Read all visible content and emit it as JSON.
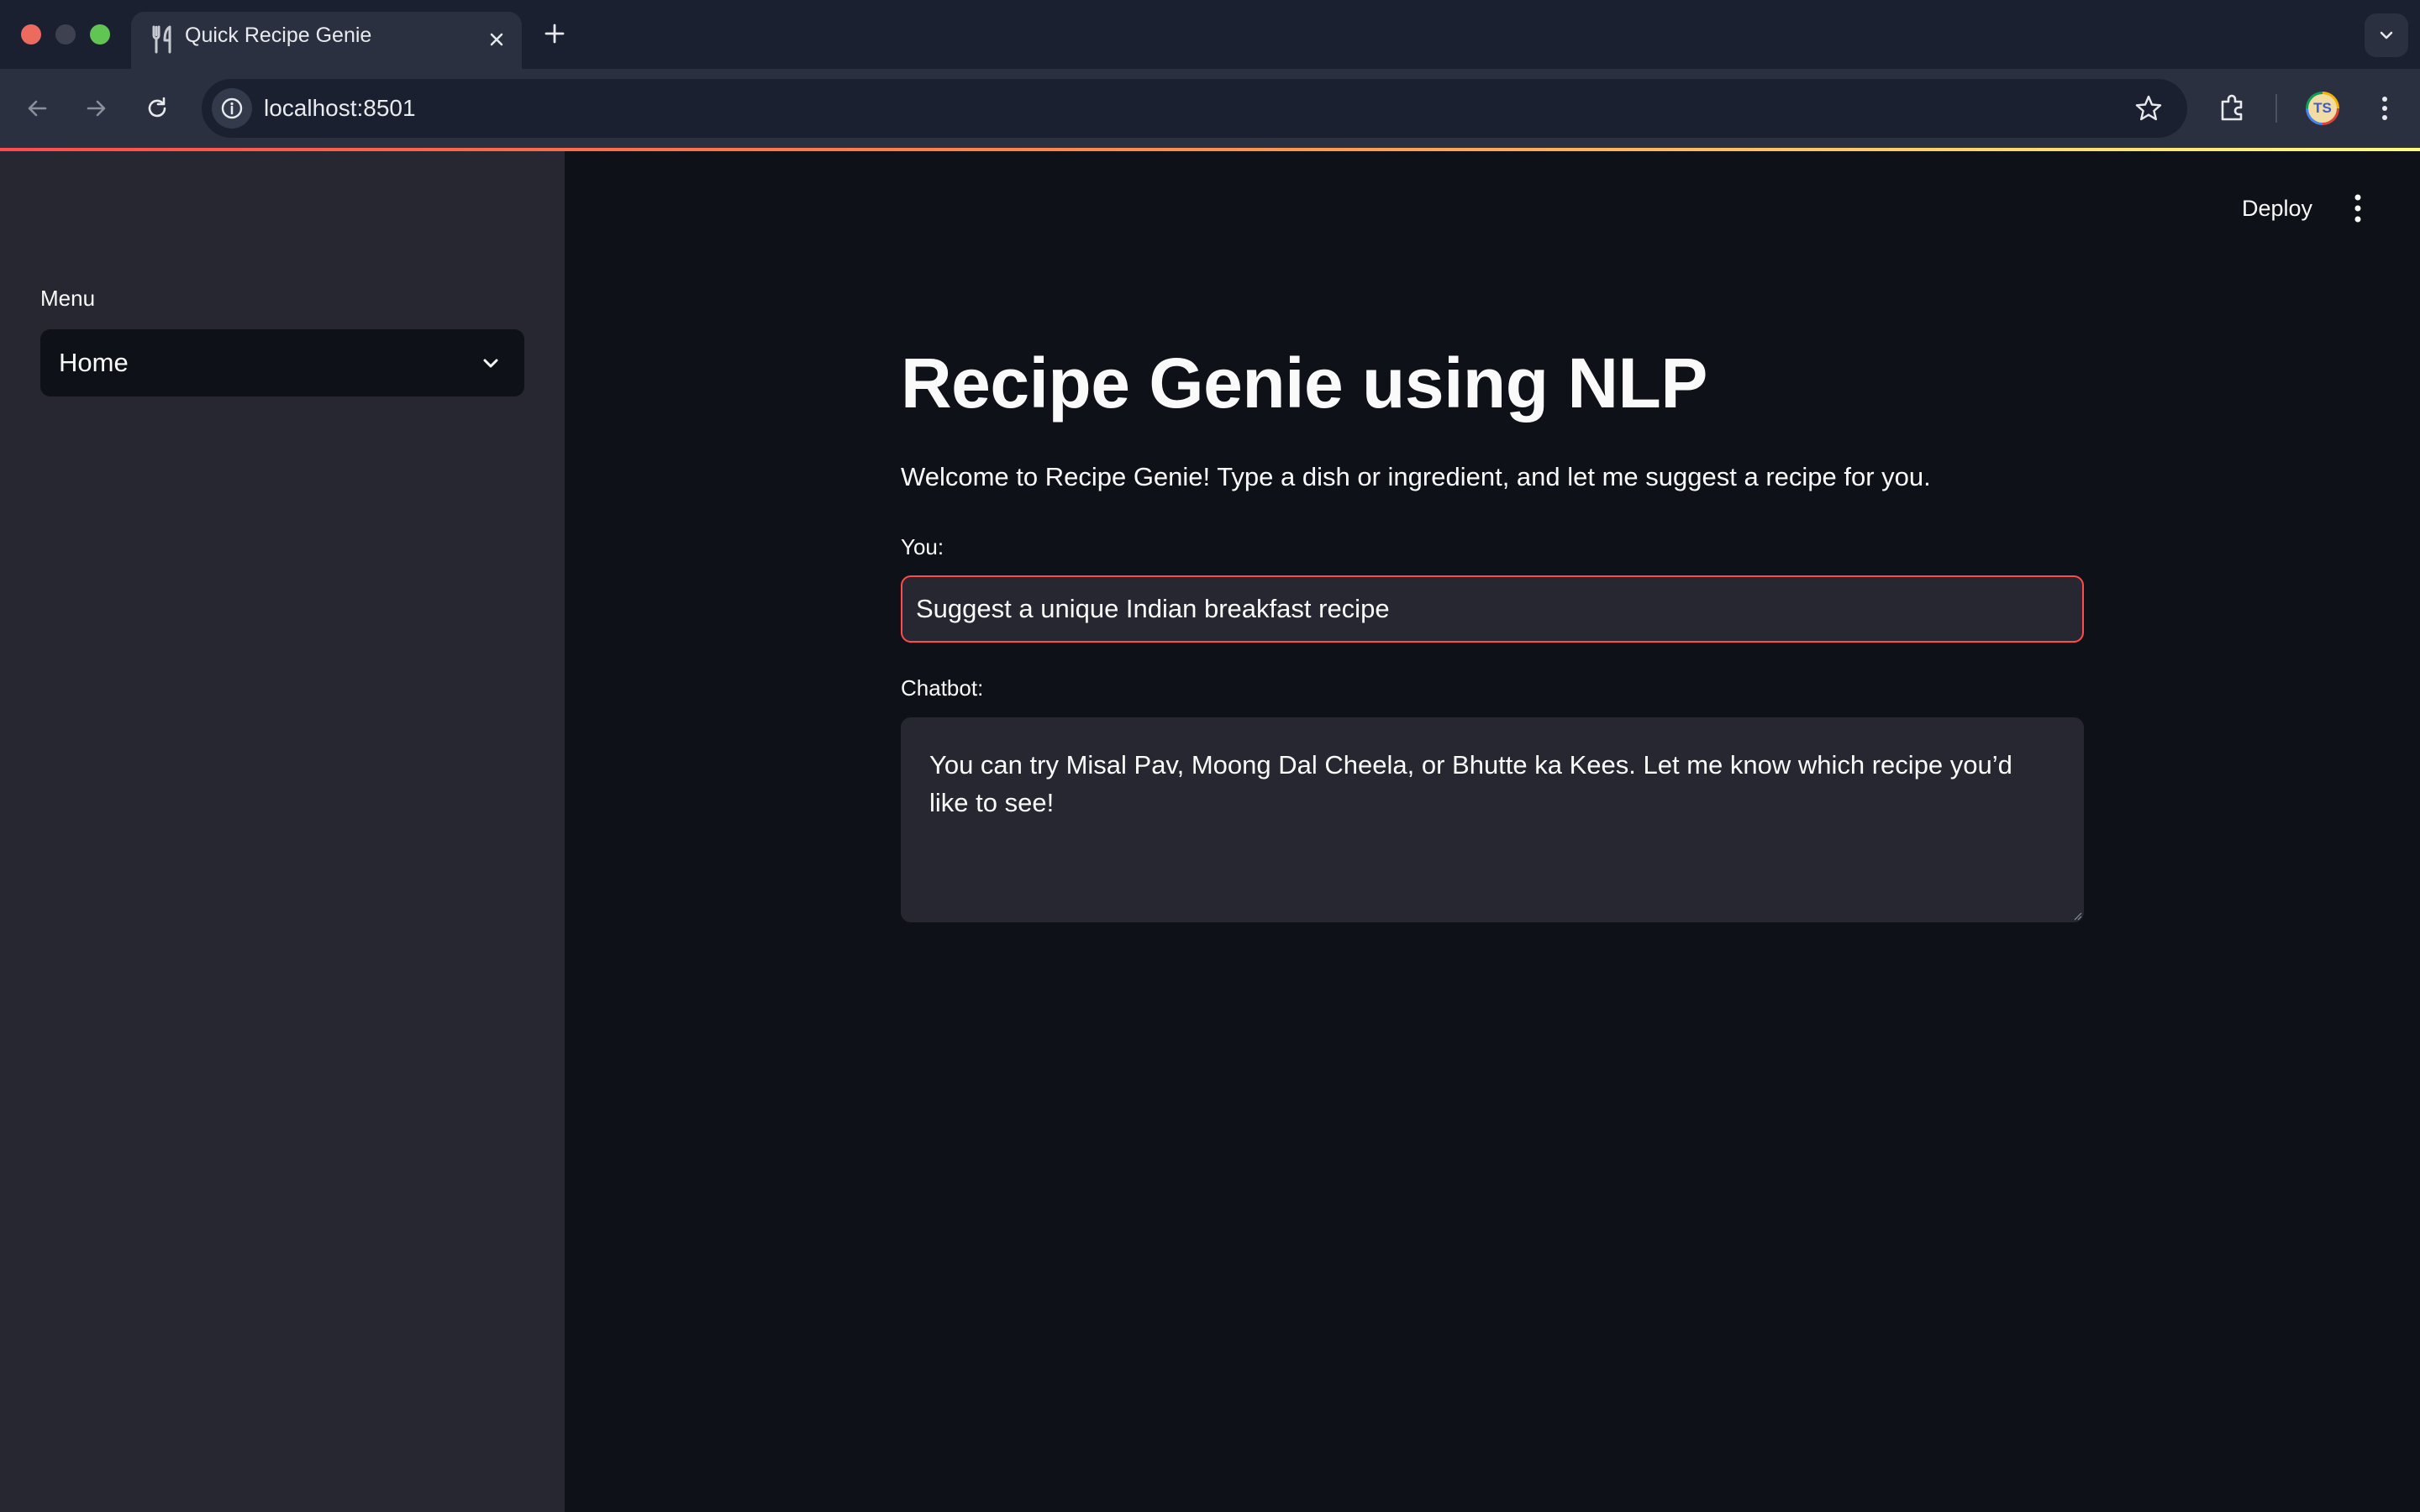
{
  "browser": {
    "tab_title": "Quick Recipe Genie",
    "url": "localhost:8501",
    "avatar_initials": "TS"
  },
  "sidebar": {
    "menu_label": "Menu",
    "selected_page": "Home"
  },
  "header": {
    "deploy_label": "Deploy"
  },
  "main": {
    "title": "Recipe Genie using NLP",
    "intro": "Welcome to Recipe Genie! Type a dish or ingredient, and let me suggest a recipe for you.",
    "user_label": "You:",
    "user_input_value": "Suggest a unique Indian breakfast recipe",
    "bot_label": "Chatbot:",
    "bot_response": "You can try Misal Pav, Moong Dal Cheela, or Bhutte ka Kees. Let me know which recipe you’d like to see!"
  },
  "colors": {
    "accent": "#ff4b4b",
    "background": "#0e1117",
    "sidebar": "#262730"
  },
  "icons": [
    "fork-knife-icon",
    "close-icon",
    "plus-icon",
    "chevron-down-icon",
    "back-arrow-icon",
    "forward-arrow-icon",
    "reload-icon",
    "info-icon",
    "star-icon",
    "extension-icon",
    "kebab-menu-icon"
  ]
}
